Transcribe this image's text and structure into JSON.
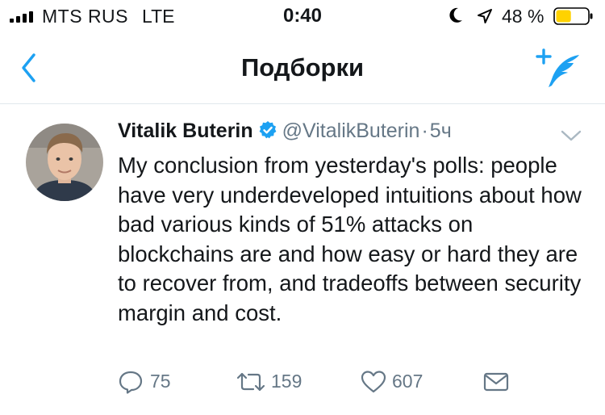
{
  "status_bar": {
    "carrier": "MTS RUS",
    "network": "LTE",
    "time": "0:40",
    "battery_percent": "48 %",
    "battery_level": 0.48,
    "battery_color": "#ffd200",
    "icons": [
      "signal-bars-icon",
      "moon-icon",
      "location-arrow-icon",
      "battery-icon"
    ]
  },
  "nav": {
    "title": "Подборки",
    "back_icon": "chevron-left-icon",
    "compose_icon": "compose-feather-icon",
    "accent_color": "#1da1f2"
  },
  "tweet": {
    "author_name": "Vitalik Buterin",
    "verified": true,
    "handle": "@VitalikButerin",
    "separator": "·",
    "time": "5ч",
    "text": "My conclusion from yesterday's polls: people have very underdeveloped intuitions about how bad various kinds of 51% attacks on blockchains are and how easy or hard they are to recover from, and tradeoffs between security margin and cost.",
    "actions": {
      "replies": "75",
      "retweets": "159",
      "likes": "607"
    }
  }
}
